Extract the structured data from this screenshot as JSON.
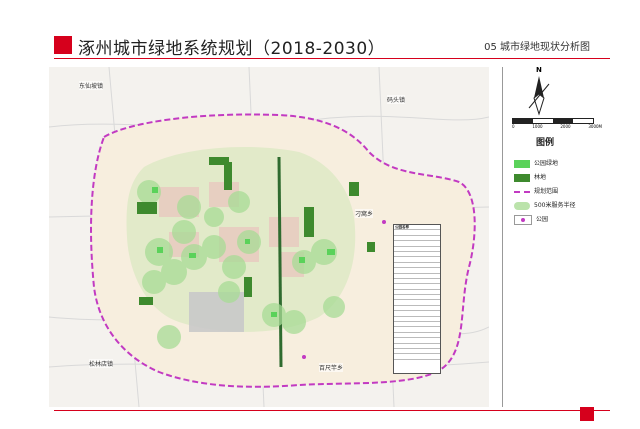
{
  "header": {
    "title": "涿州城市绿地系统规划（2018-2030）",
    "subtitle": "05 城市绿地现状分析图"
  },
  "legend": {
    "title": "图例",
    "items": [
      {
        "label": "公园绿地",
        "color": "#5ad25a"
      },
      {
        "label": "林地",
        "color": "#3e8a2e"
      },
      {
        "label": "规划范围",
        "color": "#c23ac2"
      },
      {
        "label": "500米服务半径",
        "color": "#a8dc96"
      },
      {
        "label": "公园",
        "color": "#c23ac2"
      }
    ]
  },
  "scale_bar": {
    "labels": [
      "0",
      "1000",
      "2000",
      "3000M"
    ]
  },
  "compass": {
    "label": "N"
  },
  "places": {
    "dongxianpo": "东仙坡镇",
    "matou": "码头镇",
    "diaowo": "刁窝乡",
    "songlin": "松林店镇",
    "baiyun": "百尺竿乡"
  },
  "table": {
    "header": "公园名称",
    "rows": 24
  }
}
